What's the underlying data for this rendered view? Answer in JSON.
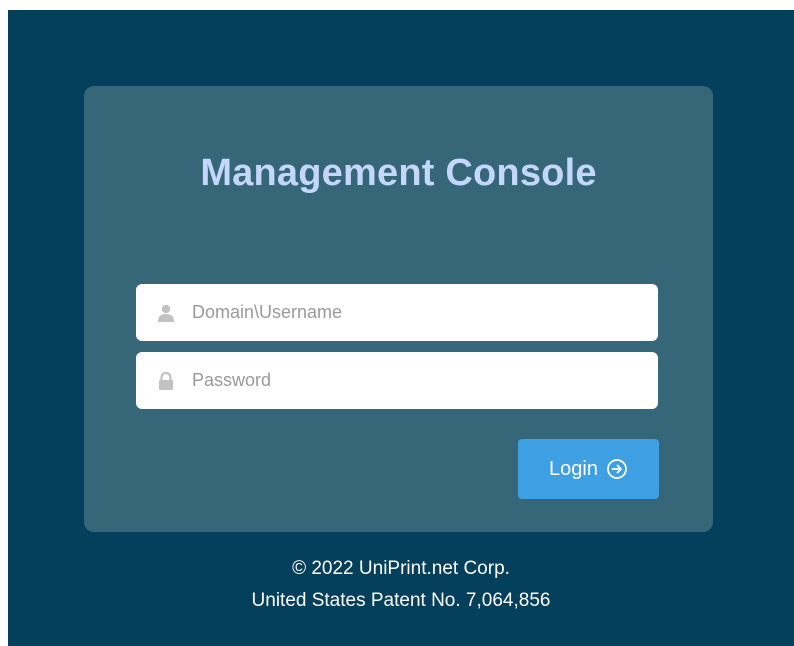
{
  "title": "Management Console",
  "username": {
    "placeholder": "Domain\\Username",
    "value": "",
    "icon": "user-icon"
  },
  "password": {
    "placeholder": "Password",
    "value": "",
    "icon": "lock-icon"
  },
  "login_button": {
    "label": "Login",
    "icon": "arrow-right-circle-icon"
  },
  "footer": {
    "copyright": "© 2022 UniPrint.net Corp.",
    "patent": "United States Patent No. 7,064,856"
  },
  "colors": {
    "background": "#043f5b",
    "card": "#356779",
    "title": "#c4d7fb",
    "button": "#3f9fe3"
  }
}
